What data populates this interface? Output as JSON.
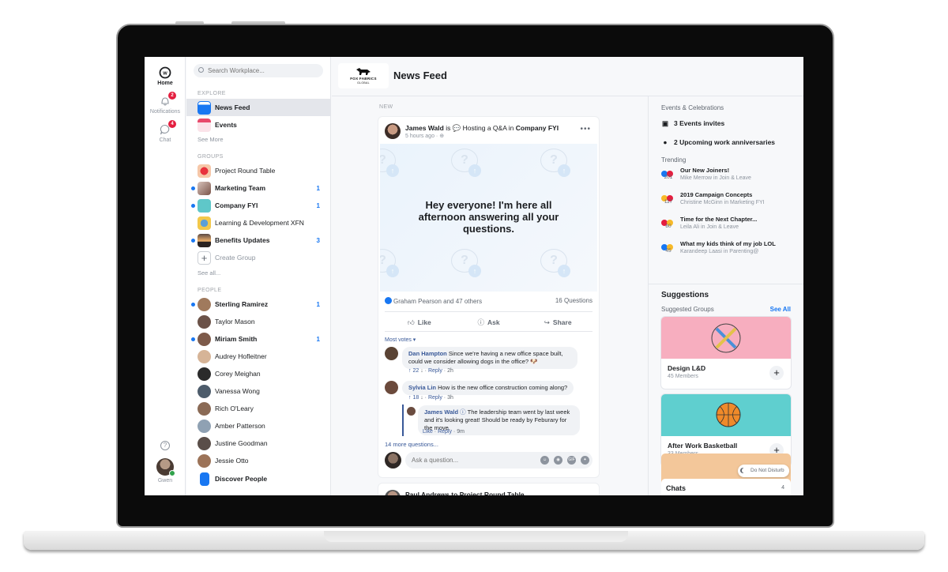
{
  "rail": {
    "home_label": "Home",
    "notifications_label": "Notifications",
    "notifications_badge": "2",
    "chat_label": "Chat",
    "chat_badge": "4",
    "user_name": "Gwen"
  },
  "nav": {
    "search_placeholder": "Search Workplace...",
    "explore_label": "EXPLORE",
    "explore_items": [
      {
        "label": "News Feed",
        "icon": "news-feed-icon",
        "selected": true
      },
      {
        "label": "Events",
        "icon": "calendar-icon"
      }
    ],
    "see_more": "See More",
    "groups_label": "GROUPS",
    "groups": [
      {
        "label": "Project Round Table",
        "unread": false,
        "count": "",
        "color": "#f6c7a8"
      },
      {
        "label": "Marketing Team",
        "unread": true,
        "count": "1",
        "color": "#a97f73"
      },
      {
        "label": "Company FYI",
        "unread": true,
        "count": "1",
        "color": "#5fc7c9"
      },
      {
        "label": "Learning & Development XFN",
        "unread": false,
        "count": "",
        "color": "#f2c84b"
      },
      {
        "label": "Benefits Updates",
        "unread": true,
        "count": "3",
        "color": "#5b4a45"
      }
    ],
    "create_group": "Create Group",
    "see_all": "See all...",
    "people_label": "PEOPLE",
    "people": [
      {
        "label": "Sterling Ramirez",
        "unread": true,
        "count": "1"
      },
      {
        "label": "Taylor Mason",
        "unread": false,
        "count": ""
      },
      {
        "label": "Miriam Smith",
        "unread": true,
        "count": "1"
      },
      {
        "label": "Audrey Hofleitner",
        "unread": false,
        "count": ""
      },
      {
        "label": "Corey Meighan",
        "unread": false,
        "count": ""
      },
      {
        "label": "Vanessa Wong",
        "unread": false,
        "count": ""
      },
      {
        "label": "Rich O'Leary",
        "unread": false,
        "count": ""
      },
      {
        "label": "Amber Patterson",
        "unread": false,
        "count": ""
      },
      {
        "label": "Justine Goodman",
        "unread": false,
        "count": ""
      },
      {
        "label": "Jessie Otto",
        "unread": false,
        "count": ""
      }
    ],
    "discover_people": "Discover People"
  },
  "header": {
    "brand_line1": "FOX FABRICS",
    "brand_line2": "GLOBAL",
    "title": "News Feed"
  },
  "feed": {
    "section_label": "NEW",
    "post": {
      "author": "James Wald",
      "verb": " is ",
      "activity": "Hosting a Q&A",
      "in_word": " in ",
      "group": "Company FYI",
      "time": "5 hours ago · ",
      "body": "Hey everyone! I'm here all afternoon answering all your questions.",
      "reactions_text": "Graham Pearson and 47 others",
      "questions_count": "16 Questions",
      "actions": {
        "like": "Like",
        "ask": "Ask",
        "share": "Share"
      },
      "sort_label": "Most votes ▾",
      "comments": [
        {
          "author": "Dan Hampton",
          "text": "Since we're having a new office space built, could we consider allowing dogs in the office? 🐶",
          "votes": "22",
          "reply": "Reply",
          "time": "2h"
        },
        {
          "author": "Sylvia Lin",
          "text": "How is the new office construction coming along?",
          "votes": "18",
          "reply": "Reply",
          "time": "3h"
        }
      ],
      "reply": {
        "author": "James Wald",
        "text": "The leadership team went by last week and it's looking great! Should be ready by Feburary for the move.",
        "like": "Like",
        "reply": "Reply",
        "time": "9m"
      },
      "more_questions": "14 more questions...",
      "ask_placeholder": "Ask a question..."
    },
    "next_post_heading": "Paul Andrews to Project Round Table"
  },
  "right": {
    "events_title": "Events & Celebrations",
    "events_invites": "3 Events invites",
    "anniversaries": "2 Upcoming work anniversaries",
    "trending_title": "Trending",
    "trending": [
      {
        "title": "Our New Joiners!",
        "author": "Mike Merrow",
        "group": "Join & Leave",
        "count": "201",
        "reacts": [
          "#1877f2",
          "#e41e3f"
        ]
      },
      {
        "title": "2019 Campaign Concepts",
        "author": "Christine McGinn",
        "group": "Marketing FYI",
        "count": "117",
        "reacts": [
          "#f7b928",
          "#e41e3f"
        ]
      },
      {
        "title": "Time for the Next Chapter...",
        "author": "Leila Ali",
        "group": "Join & Leave",
        "count": "80",
        "reacts": [
          "#e41e3f",
          "#f7b928"
        ]
      },
      {
        "title": "What my kids think of my job LOL",
        "author": "Karandeep Laasi",
        "group": "Parenting@",
        "count": "45",
        "reacts": [
          "#1877f2",
          "#f7b928"
        ]
      }
    ],
    "in_word": " in ",
    "suggestions_title": "Suggestions",
    "suggested_groups_label": "Suggested Groups",
    "see_all": "See All",
    "groups": [
      {
        "name": "Design L&D",
        "members": "45 Members",
        "color": "#f7aebf"
      },
      {
        "name": "After Work Basketball",
        "members": "33 Members",
        "color": "#5fcfcf"
      }
    ],
    "chats_title": "Chats",
    "chats_count": "4",
    "dnd_label": "Do Not Disturb"
  }
}
